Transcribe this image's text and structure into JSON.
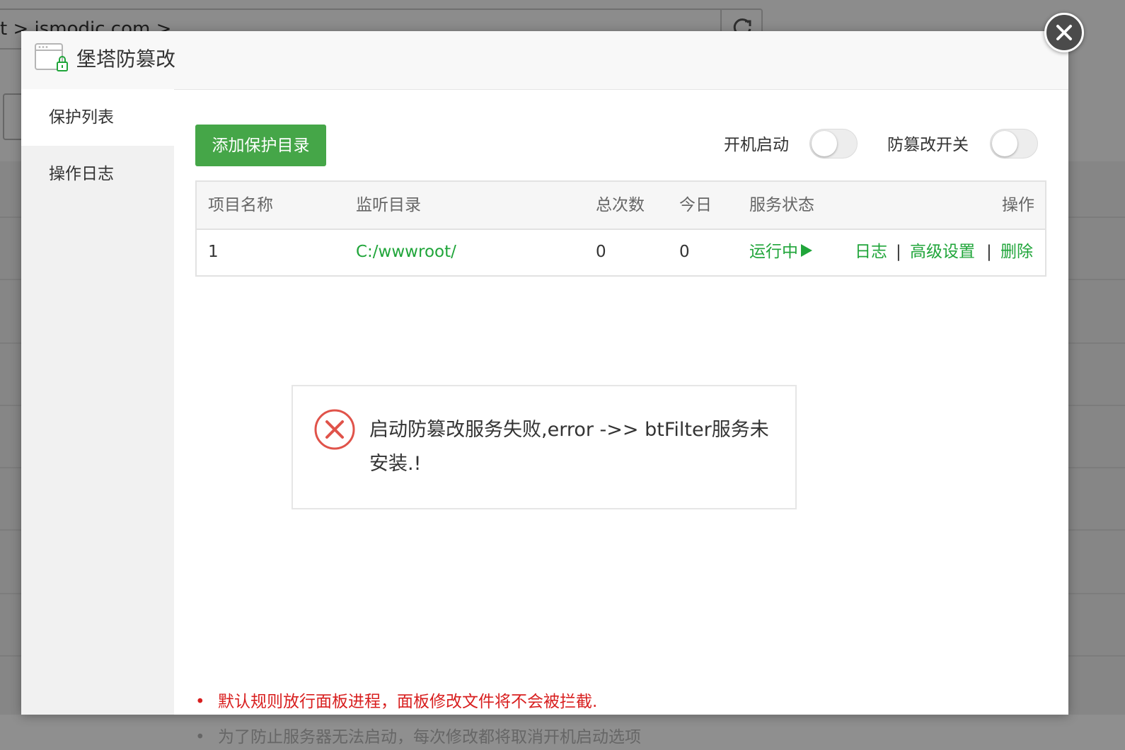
{
  "background": {
    "address": "t  >  ismodic.com  >"
  },
  "modal": {
    "title": "堡塔防篡改",
    "close_icon": "close-icon"
  },
  "sidebar": {
    "items": [
      {
        "label": "保护列表",
        "active": true
      },
      {
        "label": "操作日志",
        "active": false
      }
    ]
  },
  "toolbar": {
    "add_label": "添加保护目录",
    "boot_start_label": "开机启动",
    "boot_start_on": false,
    "tamper_switch_label": "防篡改开关",
    "tamper_switch_on": false
  },
  "table": {
    "headers": [
      "项目名称",
      "监听目录",
      "总次数",
      "今日",
      "服务状态",
      "操作"
    ],
    "rows": [
      {
        "name": "1",
        "dir": "C:/wwwroot/",
        "total": "0",
        "today": "0",
        "status": "运行中",
        "actions": [
          "日志",
          "高级设置",
          "删除"
        ],
        "separator": "|"
      }
    ]
  },
  "error": {
    "message": "启动防篡改服务失败,error ->> btFilter服务未安装.!"
  },
  "notes": {
    "bullet": "•",
    "items": [
      "默认规则放行面板进程，面板修改文件将不会被拦截.",
      "为了防止服务器无法启动，每次修改都将取消开机启动选项"
    ]
  },
  "colors": {
    "accent_green": "#20a53a",
    "error_red": "#d81f1f"
  }
}
